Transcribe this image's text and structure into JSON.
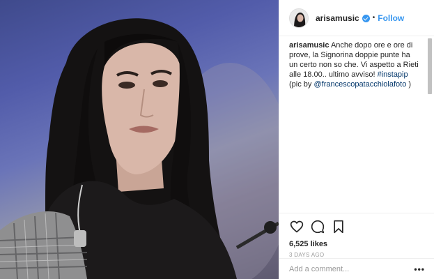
{
  "post": {
    "username": "arisamusic",
    "follow_label": "Follow",
    "separator": "•",
    "icons": {
      "verified": "verified-badge-icon",
      "like": "heart-icon",
      "comment": "comment-icon",
      "save": "bookmark-icon",
      "more": "more-options-icon"
    },
    "caption": {
      "username": "arisamusic",
      "text": "Anche dopo ore e ore di prove, la Signorina doppie punte ha un certo non so che. Vi aspetto a Rieti alle 18.00.. ultimo avviso! ",
      "hashtag": "#instapip",
      "text2": " (pic by ",
      "mention": "@francescopatacchiolafoto",
      "text3": " )"
    },
    "likes": "6,525 likes",
    "time": "3 DAYS AGO",
    "comment_placeholder": "Add a comment...",
    "more_label": "•••"
  },
  "colors": {
    "accent": "#3897f0",
    "link": "#003569",
    "text": "#262626",
    "muted": "#999999"
  }
}
